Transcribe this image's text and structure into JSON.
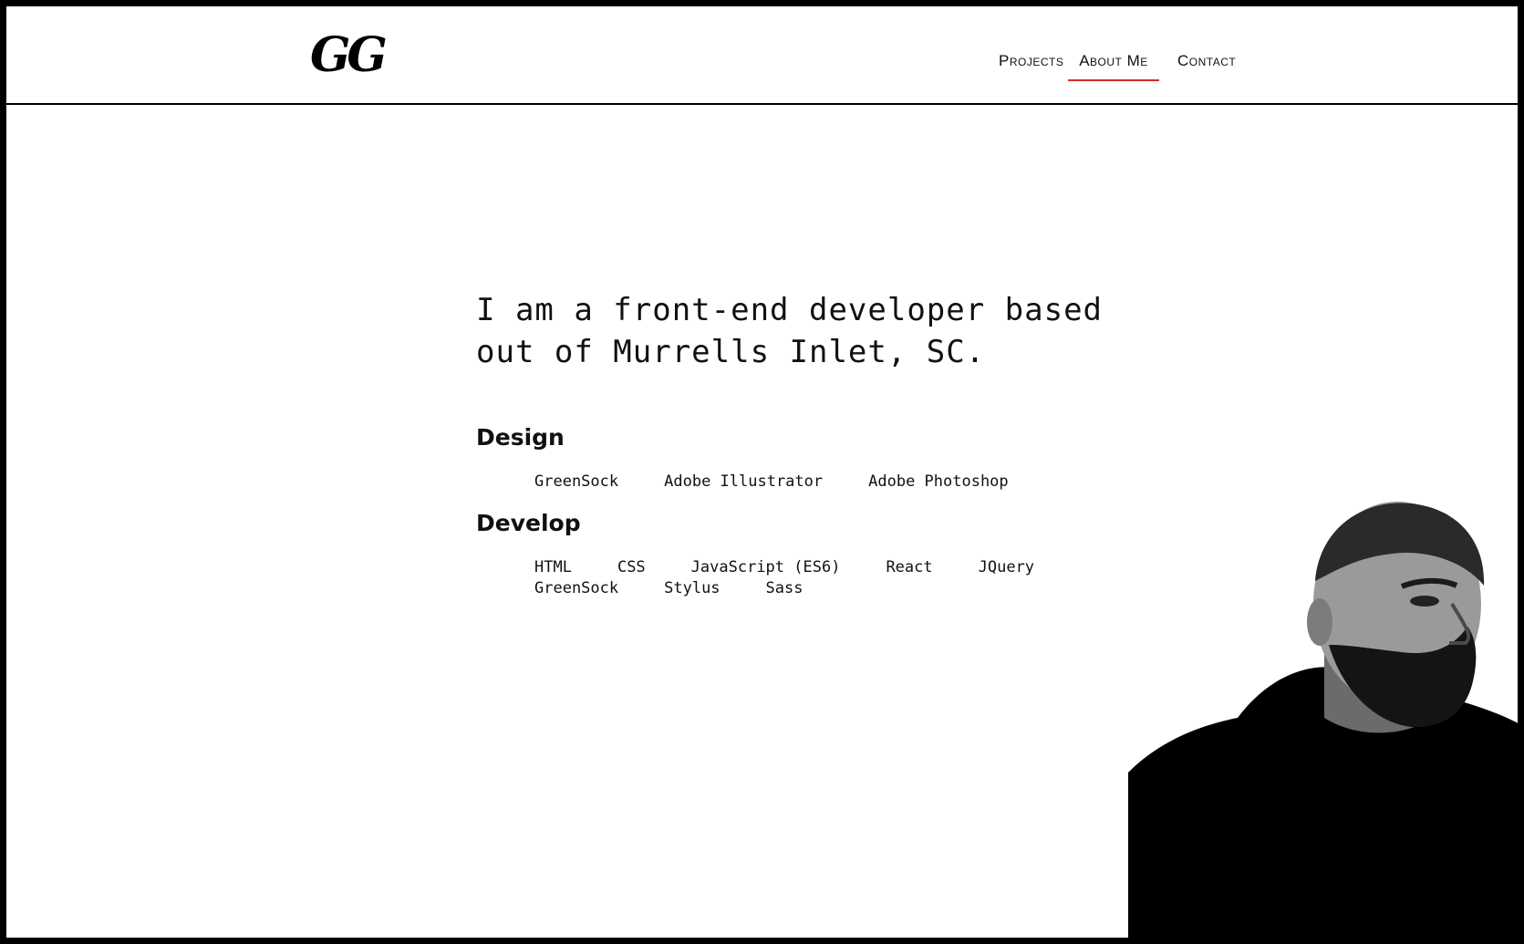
{
  "header": {
    "logo_text": "GG",
    "nav": {
      "projects": "Projects",
      "about": "About Me",
      "contact": "Contact"
    },
    "active_color": "#d62a2a"
  },
  "main": {
    "intro_line1": "I am a front-end developer based",
    "intro_line2": "out of Murrells Inlet, SC.",
    "design": {
      "heading": "Design",
      "skills": [
        "GreenSock",
        "Adobe Illustrator",
        "Adobe Photoshop"
      ]
    },
    "develop": {
      "heading": "Develop",
      "skills": [
        "HTML",
        "CSS",
        "JavaScript (ES6)",
        "React",
        "JQuery",
        "GreenSock",
        "Stylus",
        "Sass"
      ]
    }
  }
}
